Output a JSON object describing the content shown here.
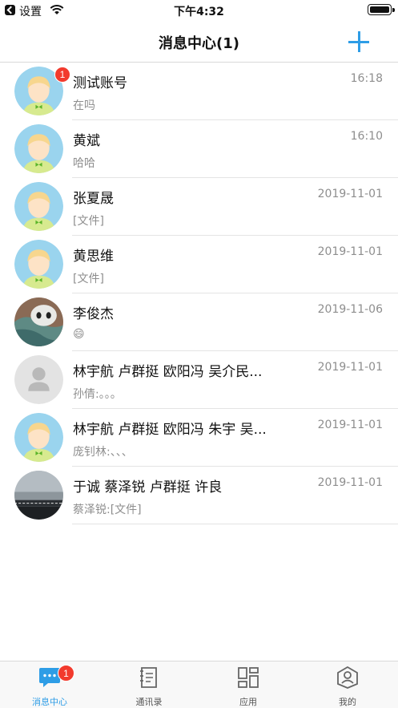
{
  "status_bar": {
    "back_label": "设置",
    "time": "下午4:32"
  },
  "nav": {
    "title": "消息中心(1)",
    "add_icon": "plus-icon",
    "accent": "#2e9de6"
  },
  "conversations": [
    {
      "name": "测试账号",
      "time": "16:18",
      "preview": "在吗",
      "badge": "1",
      "avatar": "cartoon"
    },
    {
      "name": "黄斌",
      "time": "16:10",
      "preview": "哈哈",
      "avatar": "cartoon"
    },
    {
      "name": "张夏晟",
      "time": "2019-11-01",
      "preview": "[文件]",
      "avatar": "cartoon"
    },
    {
      "name": "黄思维",
      "time": "2019-11-01",
      "preview": "[文件]",
      "avatar": "cartoon"
    },
    {
      "name": "李俊杰",
      "time": "2019-11-06",
      "preview": "😄",
      "avatar": "photo-cat"
    },
    {
      "name": "林宇航 卢群挺 欧阳冯 吴介民...",
      "time": "2019-11-01",
      "preview": "孙倩:。。。",
      "avatar": "group-placeholder"
    },
    {
      "name": "林宇航 卢群挺 欧阳冯 朱宇 吴...",
      "time": "2019-11-01",
      "preview": "庞钊林:、、、",
      "avatar": "cartoon"
    },
    {
      "name": "于诚 蔡泽锐 卢群挺 许良",
      "time": "2019-11-01",
      "preview": "蔡泽锐:[文件]",
      "avatar": "photo-sea"
    }
  ],
  "tabbar": {
    "tabs": [
      {
        "label": "消息中心",
        "icon": "chat-bubble-icon",
        "active": true,
        "badge": "1"
      },
      {
        "label": "通讯录",
        "icon": "contacts-book-icon"
      },
      {
        "label": "应用",
        "icon": "apps-grid-icon"
      },
      {
        "label": "我的",
        "icon": "profile-icon"
      }
    ]
  },
  "colors": {
    "badge": "#f23a2d",
    "active_tab": "#2e9de6",
    "secondary_text": "#8e8e8e"
  }
}
